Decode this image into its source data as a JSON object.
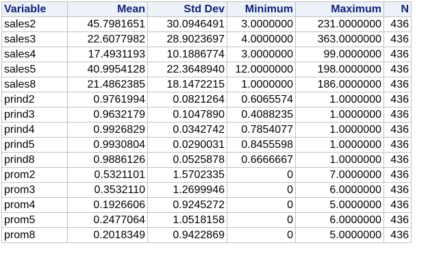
{
  "table": {
    "headers": [
      "Variable",
      "Mean",
      "Std Dev",
      "Minimum",
      "Maximum",
      "N"
    ],
    "rows": [
      [
        "sales2",
        "45.7981651",
        "30.0946491",
        "3.0000000",
        "231.0000000",
        "436"
      ],
      [
        "sales3",
        "22.6077982",
        "28.9023697",
        "4.0000000",
        "363.0000000",
        "436"
      ],
      [
        "sales4",
        "17.4931193",
        "10.1886774",
        "3.0000000",
        "99.0000000",
        "436"
      ],
      [
        "sales5",
        "40.9954128",
        "22.3648940",
        "12.0000000",
        "198.0000000",
        "436"
      ],
      [
        "sales8",
        "21.4862385",
        "18.1472215",
        "1.0000000",
        "186.0000000",
        "436"
      ],
      [
        "prind2",
        "0.9761994",
        "0.0821264",
        "0.6065574",
        "1.0000000",
        "436"
      ],
      [
        "prind3",
        "0.9632179",
        "0.1047890",
        "0.4088235",
        "1.0000000",
        "436"
      ],
      [
        "prind4",
        "0.9926829",
        "0.0342742",
        "0.7854077",
        "1.0000000",
        "436"
      ],
      [
        "prind5",
        "0.9930804",
        "0.0290031",
        "0.8455598",
        "1.0000000",
        "436"
      ],
      [
        "prind8",
        "0.9886126",
        "0.0525878",
        "0.6666667",
        "1.0000000",
        "436"
      ],
      [
        "prom2",
        "0.5321101",
        "1.5702335",
        "0",
        "7.0000000",
        "436"
      ],
      [
        "prom3",
        "0.3532110",
        "1.2699946",
        "0",
        "6.0000000",
        "436"
      ],
      [
        "prom4",
        "0.1926606",
        "0.9245272",
        "0",
        "5.0000000",
        "436"
      ],
      [
        "prom5",
        "0.2477064",
        "1.0518158",
        "0",
        "6.0000000",
        "436"
      ],
      [
        "prom8",
        "0.2018349",
        "0.9422869",
        "0",
        "5.0000000",
        "436"
      ]
    ]
  },
  "colors": {
    "header_text": "#112277",
    "header_background": "#edf2f9",
    "grid_line": "#c1c1c1"
  }
}
